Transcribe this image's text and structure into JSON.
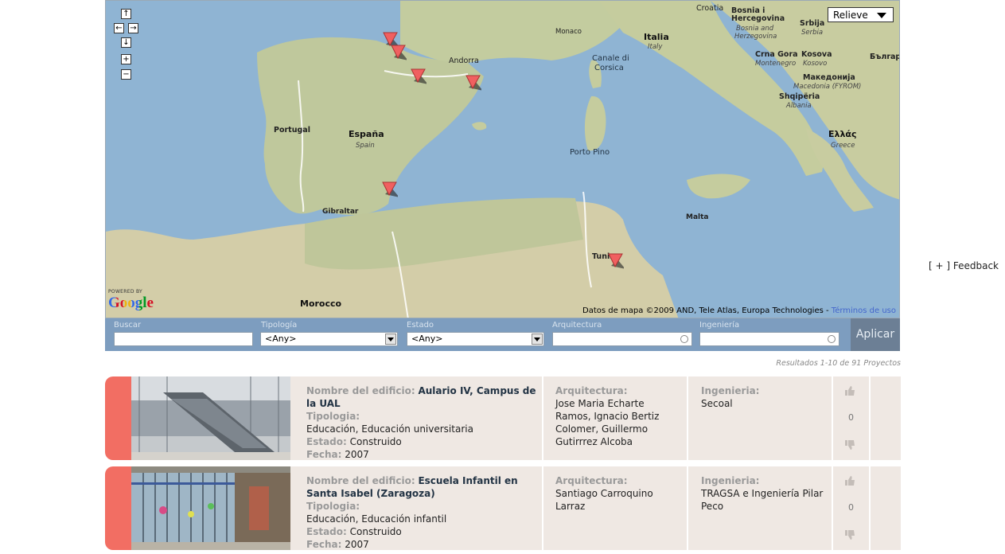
{
  "map": {
    "labels": {
      "croatia": "Croatia",
      "bosnia": "Bosnia i",
      "hercegovina": "Hercegovina",
      "bosnia_sub": "Bosnia and",
      "hercegovina_sub": "Herzegovina",
      "srbija": "Srbija",
      "serbia_sub": "Serbia",
      "italia": "Italia",
      "italy_sub": "Italy",
      "monaco": "Monaco",
      "andorra": "Andorra",
      "canale": "Canale di",
      "corsica": "Corsica",
      "crna_gora": "Crna Gora",
      "montenegro_sub": "Montenegro",
      "kosova": "Kosova",
      "kosovo_sub": "Kosovo",
      "bulgaria": "Бълrap",
      "makedonija": "Македонија",
      "macedonia_sub": "Macedonia (FYROM)",
      "shqiperia": "Shqipëria",
      "albania_sub": "Albania",
      "ellas": "Ελλάς",
      "greece_sub": "Greece",
      "portugal": "Portugal",
      "espana": "España",
      "spain_sub": "Spain",
      "porto_pino": "Porto Pino",
      "gibraltar": "Gibraltar",
      "malta": "Malta",
      "tunis": "Tunis",
      "morocco": "Morocco"
    },
    "map_type": "Relieve",
    "powered_by": "POWERED BY",
    "logo": "Google",
    "attribution": "Datos de mapa ©2009 AND, Tele Atlas, Europa Technologies - ",
    "terms_link": "Términos de uso"
  },
  "filters": {
    "buscar_label": "Buscar",
    "tipologia_label": "Tipología",
    "tipologia_value": "<Any>",
    "estado_label": "Estado",
    "estado_value": "<Any>",
    "arquitectura_label": "Arquitectura",
    "ingenieria_label": "Ingeniería",
    "apply_label": "Aplicar"
  },
  "results_count": "Resultados 1-10 de 91 Proyectos",
  "results": [
    {
      "name_label": "Nombre del edificio:",
      "name": "Aulario IV, Campus de la UAL",
      "tipologia_label": "Tipologia:",
      "tipologia": "Educación, Educación universitaria",
      "estado_label": "Estado:",
      "estado": "Construido",
      "fecha_label": "Fecha:",
      "fecha": "2007",
      "arq_label": "Arquitectura:",
      "arq": "Jose Maria Echarte Ramos, Ignacio Bertiz Colomer, Guillermo Gutirrrez Alcoba",
      "ing_label": "Ingenieria:",
      "ing": "Secoal",
      "votes": "0"
    },
    {
      "name_label": "Nombre del edificio:",
      "name": "Escuela Infantil en Santa Isabel (Zaragoza)",
      "tipologia_label": "Tipologia:",
      "tipologia": "Educación, Educación infantil",
      "estado_label": "Estado:",
      "estado": "Construido",
      "fecha_label": "Fecha:",
      "fecha": "2007",
      "arq_label": "Arquitectura:",
      "arq": "Santiago Carroquino Larraz",
      "ing_label": "Ingenieria:",
      "ing": "TRAGSA e Ingeniería Pilar Peco",
      "votes": "0"
    }
  ],
  "feedback": "[ + ] Feedback",
  "colors": {
    "accent": "#f26e63",
    "card_bg": "#efe8e3",
    "filter_bar": "#7d9dbf",
    "sea": "#8fb4d3",
    "land": "#b9c79a"
  }
}
